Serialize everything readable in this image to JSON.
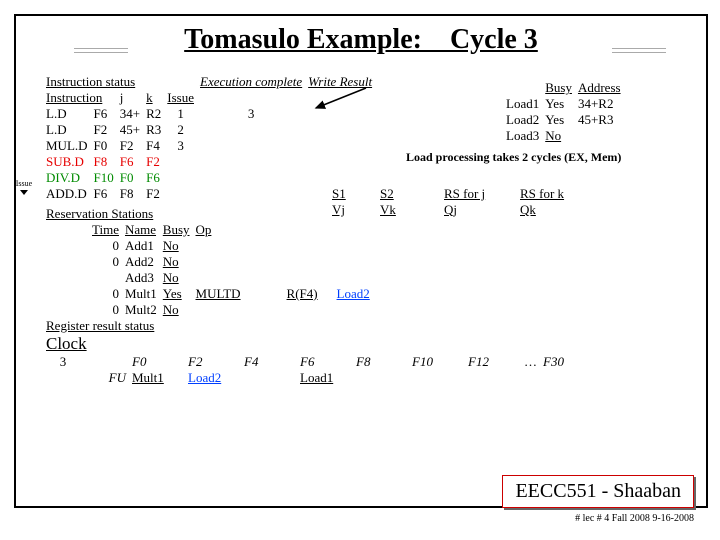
{
  "title": "Tomasulo Example: Cycle 3",
  "issue_marker": "Issue",
  "instr_status": {
    "heading": "Instruction status",
    "cols": {
      "instr": "Instruction",
      "j": "j",
      "k": "k",
      "issue": "Issue",
      "exec": "Execution complete",
      "write": "Write Result"
    },
    "rows": [
      {
        "op": "L.D",
        "dest": "F6",
        "j": "34+",
        "k": "R2",
        "issue": "1",
        "exec": "3",
        "write": "",
        "color": ""
      },
      {
        "op": "L.D",
        "dest": "F2",
        "j": "45+",
        "k": "R3",
        "issue": "2",
        "exec": "",
        "write": "",
        "color": ""
      },
      {
        "op": "MUL.D",
        "dest": "F0",
        "j": "F2",
        "k": "F4",
        "issue": "3",
        "exec": "",
        "write": "",
        "color": ""
      },
      {
        "op": "SUB.D",
        "dest": "F8",
        "j": "F6",
        "k": "F2",
        "issue": "",
        "exec": "",
        "write": "",
        "color": "red"
      },
      {
        "op": "DIV.D",
        "dest": "F10",
        "j": "F0",
        "k": "F6",
        "issue": "",
        "exec": "",
        "write": "",
        "color": "green"
      },
      {
        "op": "ADD.D",
        "dest": "F6",
        "j": "F8",
        "k": "F2",
        "issue": "",
        "exec": "",
        "write": "",
        "color": ""
      }
    ]
  },
  "load_table": {
    "cols": {
      "busy": "Busy",
      "addr": "Address"
    },
    "rows": [
      {
        "name": "Load1",
        "busy": "Yes",
        "addr": "34+R2",
        "u": false
      },
      {
        "name": "Load2",
        "busy": "Yes",
        "addr": "45+R3",
        "u": false
      },
      {
        "name": "Load3",
        "busy": "No",
        "addr": "",
        "u": true
      }
    ]
  },
  "load_note": "Load processing takes 2 cycles  (EX, Mem)",
  "reservation": {
    "heading": "Reservation Stations",
    "cols": {
      "time": "Time",
      "name": "Name",
      "busy": "Busy",
      "op": "Op",
      "s1": "S1",
      "vj": "Vj",
      "s2": "S2",
      "vk": "Vk",
      "rsj": "RS for j",
      "qj": "Qj",
      "rsk": "RS for k",
      "qk": "Qk"
    },
    "rows": [
      {
        "time": "0",
        "name": "Add1",
        "busy": "No",
        "op": "",
        "vj": "",
        "vk": "",
        "qj": "",
        "qk": ""
      },
      {
        "time": "0",
        "name": "Add2",
        "busy": "No",
        "op": "",
        "vj": "",
        "vk": "",
        "qj": "",
        "qk": ""
      },
      {
        "time": "",
        "name": "Add3",
        "busy": "No",
        "op": "",
        "vj": "",
        "vk": "",
        "qj": "",
        "qk": ""
      },
      {
        "time": "0",
        "name": "Mult1",
        "busy": "Yes",
        "op": "MULTD",
        "vj": "",
        "vk": "R(F4)",
        "qj": "Load2",
        "qk": ""
      },
      {
        "time": "0",
        "name": "Mult2",
        "busy": "No",
        "op": "",
        "vj": "",
        "vk": "",
        "qj": "",
        "qk": ""
      }
    ]
  },
  "reg_status": {
    "heading": "Register result status",
    "clock_label": "Clock",
    "clock_val": "3",
    "fu_label": "FU",
    "dots": "…",
    "regs": [
      "F0",
      "F2",
      "F4",
      "F6",
      "F8",
      "F10",
      "F12"
    ],
    "last": "F30",
    "fu": [
      "Mult1",
      "Load2",
      "",
      "Load1",
      "",
      "",
      ""
    ]
  },
  "footer": {
    "course": "EECC551 - Shaaban",
    "line": "#  lec # 4  Fall 2008   9-16-2008"
  }
}
